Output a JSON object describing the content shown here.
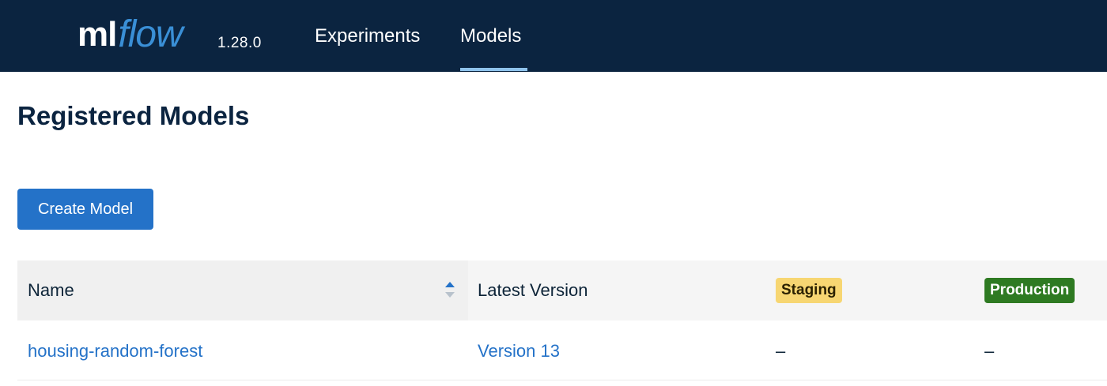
{
  "header": {
    "logo_ml": "ml",
    "logo_flow": "flow",
    "version": "1.28.0",
    "nav": [
      {
        "label": "Experiments",
        "active": false
      },
      {
        "label": "Models",
        "active": true
      }
    ]
  },
  "page": {
    "title": "Registered Models",
    "create_button": "Create Model"
  },
  "table": {
    "columns": {
      "name": "Name",
      "latest_version": "Latest Version",
      "staging": "Staging",
      "production": "Production"
    },
    "rows": [
      {
        "name": "housing-random-forest",
        "latest_version": "Version 13",
        "staging": "–",
        "production": "–"
      }
    ]
  },
  "colors": {
    "navbar": "#0b2440",
    "accent": "#2472c8",
    "staging_badge": "#f7d672",
    "production_badge": "#2e7a22"
  },
  "icons": {
    "sort": "sort-up-down-icon"
  }
}
